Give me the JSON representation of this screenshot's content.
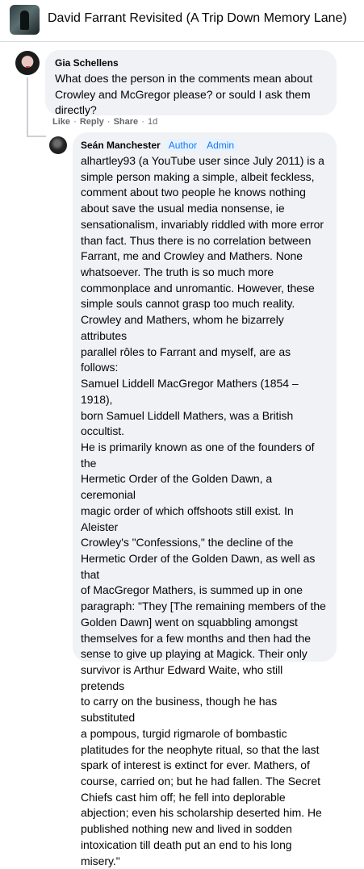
{
  "header": {
    "group_title": "David Farrant Revisited (A Trip Down Memory Lane)"
  },
  "comment_gia": {
    "author": "Gia Schellens",
    "text": "What does the person in the comments mean about\nCrowley and McGregor please? or sould I ask them\ndirectly?",
    "actions": {
      "like": "Like",
      "reply": "Reply",
      "share": "Share",
      "sep": "·",
      "time": "1d"
    }
  },
  "reply_sean": {
    "author": "Seán Manchester",
    "badges": [
      "Author",
      "Admin"
    ],
    "text": "alhartley93 (a YouTube user since July 2011) is a\nsimple person making a simple, albeit feckless,\ncomment about two people he knows nothing\nabout save the usual media nonsense, ie\nsensationalism, invariably riddled with more error\nthan fact. Thus there is no correlation between\nFarrant, me and Crowley and Mathers. None\nwhatsoever. The truth is so much more\ncommonplace and unromantic. However, these\nsimple souls cannot grasp too much reality.\nCrowley and Mathers, whom he bizarrely attributes\nparallel rôles to Farrant and myself, are as follows:\nSamuel Liddell MacGregor Mathers (1854 – 1918),\nborn Samuel Liddell Mathers, was a British occultist.\nHe is primarily known as one of the founders of the\nHermetic Order of the Golden Dawn, a ceremonial\nmagic order of which offshoots still exist. In Aleister\nCrowley's \"Confessions,\" the decline of the\nHermetic Order of the Golden Dawn, as well as that\nof MacGregor Mathers, is summed up in one\nparagraph: \"They [The remaining members of the\nGolden Dawn] went on squabbling amongst\nthemselves for a few months and then had the\nsense to give up playing at Magick. Their only\nsurvivor is Arthur Edward Waite, who still pretends\nto carry on the business, though he has substituted\na pompous, turgid rigmarole of bombastic\nplatitudes for the neophyte ritual, so that the last\nspark of interest is extinct for ever. Mathers, of\ncourse, carried on; but he had fallen. The Secret\nChiefs cast him off; he fell into deplorable\nabjection; even his scholarship deserted him. He\npublished nothing new and lived in sodden\nintoxication till death put an end to his long\nmisery.\""
  }
}
